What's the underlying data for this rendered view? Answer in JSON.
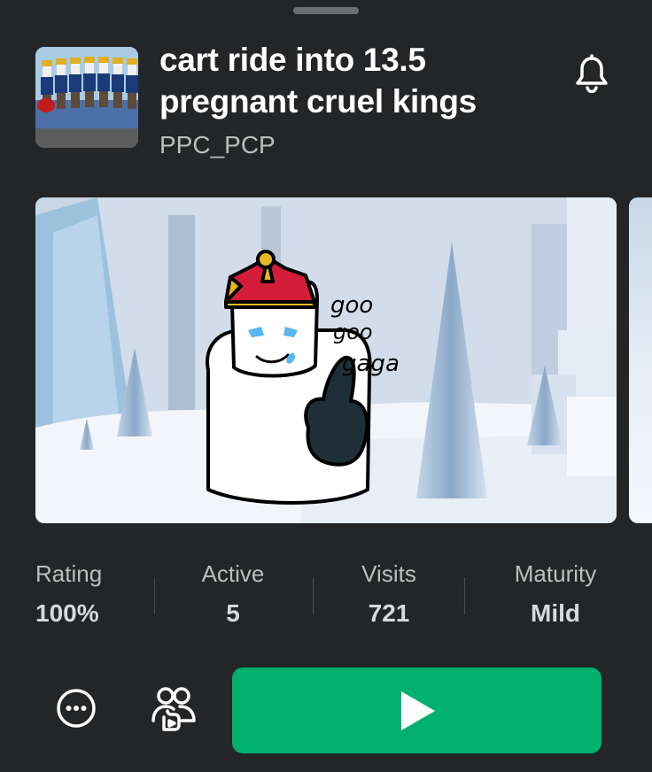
{
  "game": {
    "title": "cart ride into 13.5 pregnant cruel kings",
    "creator": "PPC_PCP"
  },
  "screenshot": {
    "handwritten_text": "goo goo gaga"
  },
  "stats": [
    {
      "label": "Rating",
      "value": "100%"
    },
    {
      "label": "Active",
      "value": "5"
    },
    {
      "label": "Visits",
      "value": "721"
    },
    {
      "label": "Maturity",
      "value": "Mild"
    }
  ],
  "icons": {
    "bell": "bell-icon",
    "more": "ellipsis-circle-icon",
    "party": "party-people-icon",
    "play": "play-icon"
  },
  "colors": {
    "background": "#232527",
    "play_button": "#00b06f",
    "text_primary": "#ffffff",
    "text_secondary": "#bdbebe"
  }
}
